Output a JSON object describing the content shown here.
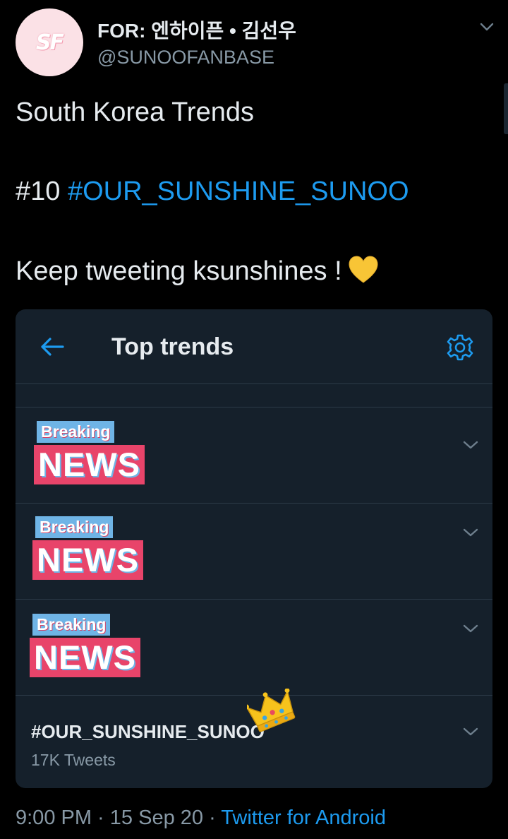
{
  "author": {
    "avatar_text": "SF",
    "display_name": "FOR: 엔하이픈 • 김선우",
    "handle": "@SUNOOFANBASE"
  },
  "tweet": {
    "line1": "South Korea Trends",
    "line2_prefix": "#10 ",
    "line2_hashtag": "#OUR_SUNSHINE_SUNOO",
    "line3": "Keep tweeting ksunshines !",
    "emoji": "yellow-heart"
  },
  "card": {
    "title": "Top trends",
    "back_icon": "back-arrow-icon",
    "settings_icon": "gear-icon",
    "sticker": {
      "breaking": "Breaking",
      "news": "NEWS"
    },
    "trends": [
      {
        "sticker": true
      },
      {
        "sticker": true
      },
      {
        "sticker": true
      },
      {
        "name": "#OUR_SUNSHINE_SUNOO",
        "count": "17K Tweets",
        "emoji": "crown"
      }
    ]
  },
  "footer": {
    "time": "9:00 PM",
    "separator": " · ",
    "date": "15 Sep 20",
    "source": "Twitter for Android"
  },
  "colors": {
    "background": "#000000",
    "card": "#15202b",
    "link": "#1d9bf0",
    "muted": "#8899a6",
    "divider": "#2c3a48"
  }
}
